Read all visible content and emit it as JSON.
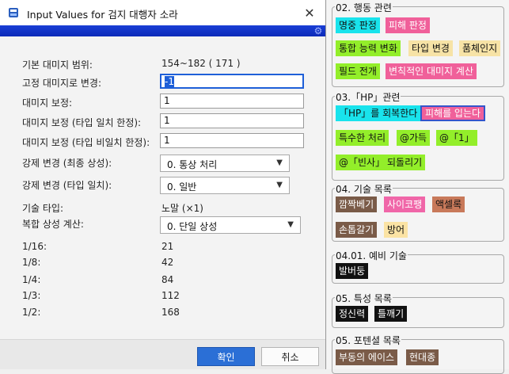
{
  "dialog": {
    "title": "Input Values for 검지 대행자 소라",
    "close_glyph": "✕",
    "base_range_label": "기본 대미지 범위:",
    "base_range_value": "154~182 ( 171 )",
    "fixed_damage_label": "고정 대미지로 변경:",
    "fixed_damage_value": "-1",
    "damage_adjust_label": "대미지 보정:",
    "damage_adjust_value": "1",
    "type_match_adjust_label": "대미지 보정 (타입 일치 한정):",
    "type_match_adjust_value": "1",
    "type_mismatch_adjust_label": "대미지 보정 (타입 비일치 한정):",
    "type_mismatch_adjust_value": "1",
    "force_final_label": "강제 변경 (최종 상성):",
    "force_final_value": "0. 통상 처리",
    "force_type_label": "강제 변경 (타입 일치):",
    "force_type_value": "0. 일반",
    "skill_type_label": "기술 타입:",
    "skill_type_value": "노말 (×1)",
    "composite_label": "복합 상성 계산:",
    "composite_value": "0. 단일 상성",
    "fractions": [
      {
        "label": "1/16:",
        "value": "21"
      },
      {
        "label": "1/8:",
        "value": "42"
      },
      {
        "label": "1/4:",
        "value": "84"
      },
      {
        "label": "1/3:",
        "value": "112"
      },
      {
        "label": "1/2:",
        "value": "168"
      }
    ],
    "ok_label": "확인",
    "cancel_label": "취소"
  },
  "panel": {
    "group1": {
      "title": "02. 행동 관련",
      "tags": [
        "명중 판정",
        "피해 판정",
        "통합 능력 변화",
        "타입 변경",
        "품체인지",
        "필드 전개",
        "변칙적인 대미지 계산"
      ]
    },
    "group2": {
      "title": "03.「HP」관련",
      "tags": [
        "「HP」를 회복한다",
        "피해를 입는다",
        "특수한 처리",
        "@가득",
        "@「1」",
        "@「빈사」",
        "되돌리기"
      ]
    },
    "group3": {
      "title": "04. 기술 목록",
      "tags": [
        "깜짝베기",
        "사이코팽",
        "액셀록",
        "손톱갈기",
        "방어"
      ]
    },
    "group4": {
      "title": "04.01. 예비 기술",
      "tags": [
        "발버둥"
      ]
    },
    "group5": {
      "title": "05. 특성 목록",
      "tags": [
        "정신력",
        "틀깨기"
      ]
    },
    "group6": {
      "title": "05. 포텐셜 목록",
      "tags": [
        "부동의 에이스",
        "현대종"
      ]
    }
  },
  "colors": {
    "accent": "#2b6fd6",
    "title_bar_band": "#1a3fd6"
  }
}
